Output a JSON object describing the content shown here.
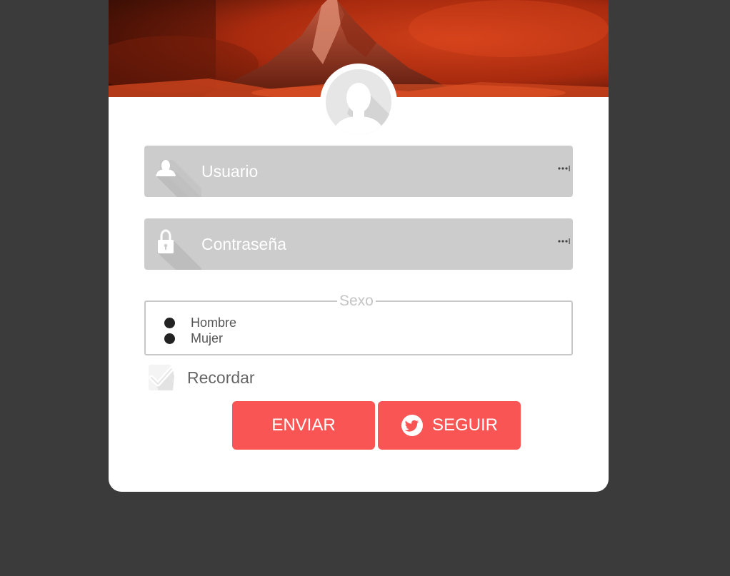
{
  "form": {
    "username_placeholder": "Usuario",
    "password_placeholder": "Contraseña",
    "gender_legend": "Sexo",
    "gender_options": [
      "Hombre",
      "Mujer"
    ],
    "remember_label": "Recordar",
    "submit_label": "ENVIAR",
    "follow_label": "SEGUIR"
  },
  "icons": {
    "username": "user-icon",
    "password": "lock-icon",
    "field_menu": "more-dots-icon",
    "remember": "checkmark-icon",
    "follow": "twitter-icon",
    "avatar": "avatar-placeholder-icon",
    "banner": "mountain-image"
  },
  "colors": {
    "background": "#3b3b3b",
    "card": "#ffffff",
    "field": "#cccccc",
    "accent": "#fa5555",
    "banner": "#c0300f"
  }
}
